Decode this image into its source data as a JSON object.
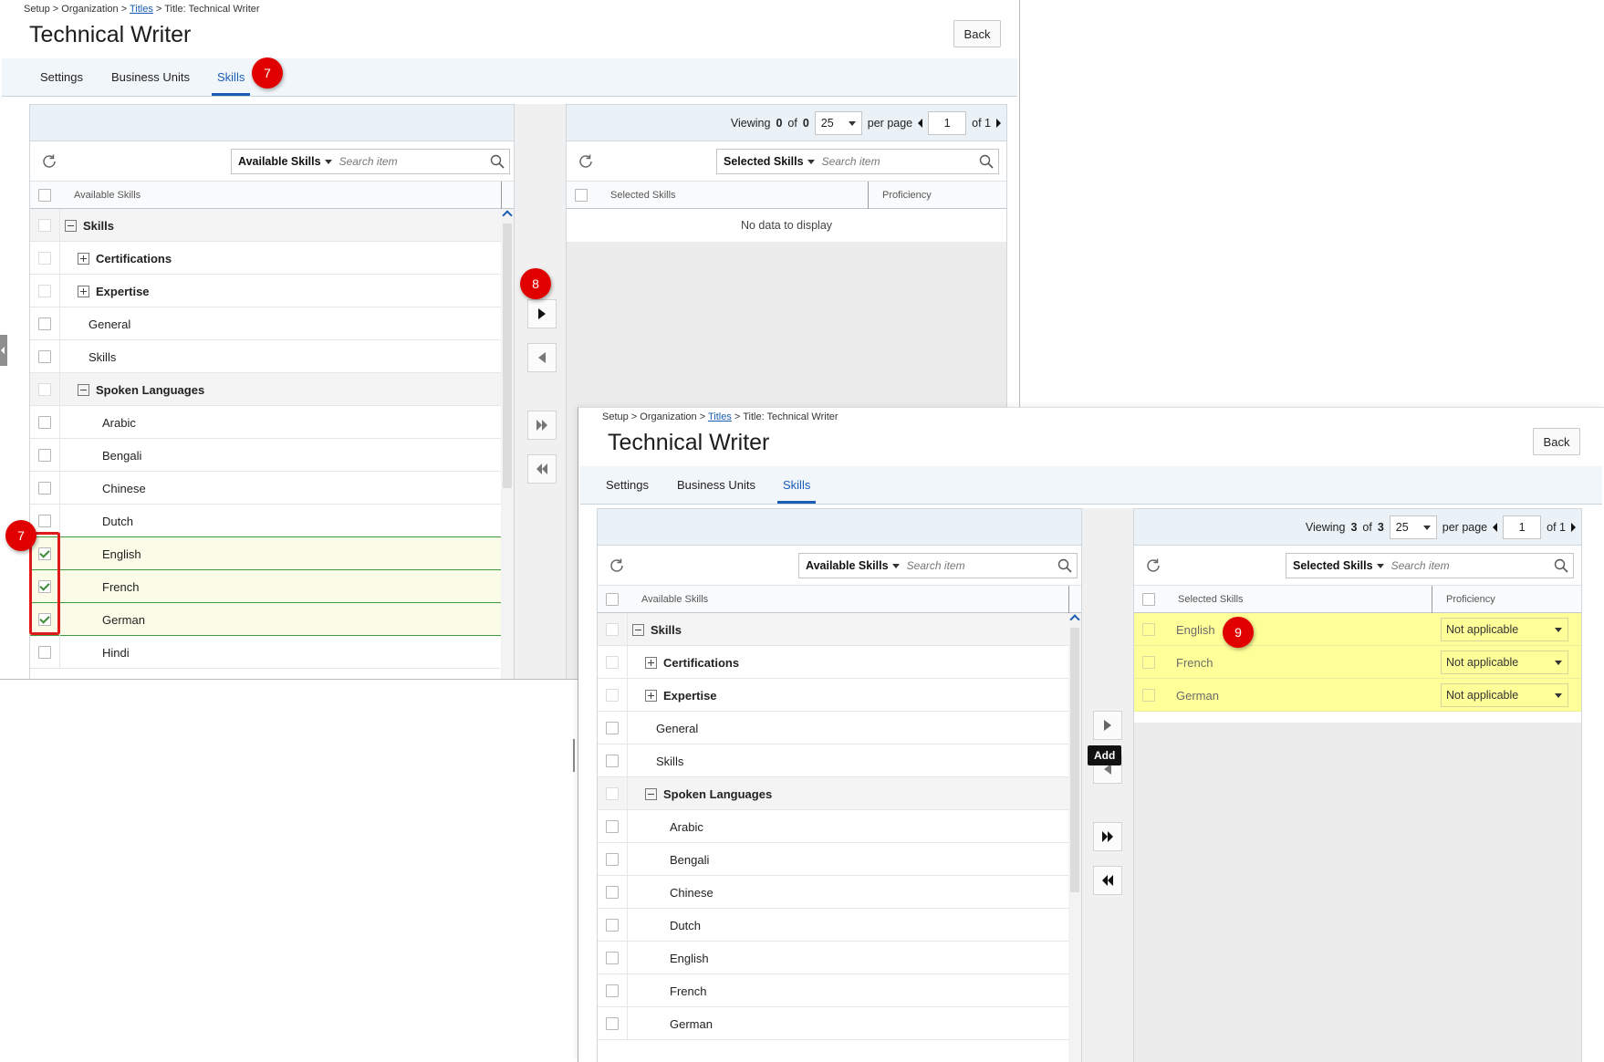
{
  "breadcrumb": {
    "p1": "Setup > Organization > ",
    "link": "Titles",
    "p2": " > Title: Technical Writer"
  },
  "title": "Technical Writer",
  "back_label": "Back",
  "tabs": [
    "Settings",
    "Business Units",
    "Skills"
  ],
  "active_tab": "Skills",
  "available": {
    "dropdown": "Available Skills",
    "search_placeholder": "Search item",
    "column": "Available Skills",
    "rows": [
      "Skills",
      "Certifications",
      "Expertise",
      "General",
      "Skills",
      "Spoken Languages",
      "Arabic",
      "Bengali",
      "Chinese",
      "Dutch",
      "English",
      "French",
      "German",
      "Hindi"
    ]
  },
  "selected": {
    "dropdown": "Selected Skills",
    "search_placeholder": "Search item",
    "col_skills": "Selected Skills",
    "col_proficiency": "Proficiency",
    "no_data": "No data to display",
    "rows": [
      {
        "skill": "English",
        "proficiency": "Not applicable"
      },
      {
        "skill": "French",
        "proficiency": "Not applicable"
      },
      {
        "skill": "German",
        "proficiency": "Not applicable"
      }
    ]
  },
  "pager": {
    "viewing": "Viewing",
    "of": "of",
    "per_page": "per page",
    "page_size": "25",
    "page": "1",
    "of_pages": "of 1",
    "before": {
      "shown": "0",
      "total": "0"
    },
    "after": {
      "shown": "3",
      "total": "3"
    }
  },
  "tooltip": "Add",
  "steps": [
    "7",
    "7",
    "8",
    "9"
  ],
  "colors": {
    "accent": "#1a5db5",
    "badge": "#e10000",
    "selected_row": "#ffff99",
    "checked_row": "#fbfce8"
  }
}
